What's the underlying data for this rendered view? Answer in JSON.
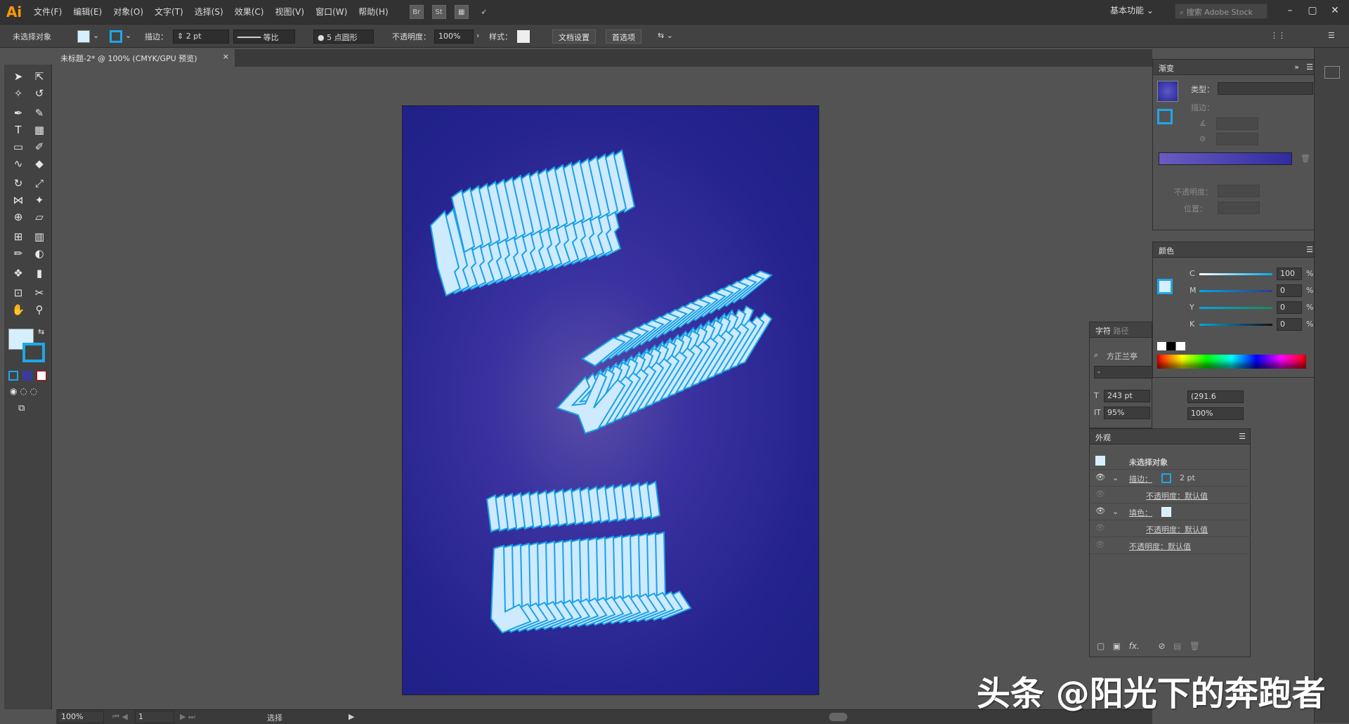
{
  "app": {
    "logo": "Ai"
  },
  "menu": [
    "文件(F)",
    "编辑(E)",
    "对象(O)",
    "文字(T)",
    "选择(S)",
    "效果(C)",
    "视图(V)",
    "窗口(W)",
    "帮助(H)"
  ],
  "menubar_icons": {
    "br": "Br",
    "st": "St"
  },
  "workspace": "基本功能",
  "stock_search": "搜索 Adobe Stock",
  "control": {
    "selection": "未选择对象",
    "stroke_label": "描边：",
    "stroke_value": "2 pt",
    "stroke_style": "等比",
    "brush": "5 点圆形",
    "opacity_label": "不透明度：",
    "opacity_value": "100%",
    "style_label": "样式：",
    "doc_setup": "文档设置",
    "prefs": "首选项",
    "fill_color": "#d6efff",
    "stroke_color": "#1fa7e6"
  },
  "document_tab": {
    "title": "未标题-2* @ 100% (CMYK/GPU 预览)",
    "close": "×"
  },
  "toolbar": {
    "tools": [
      "selection-tool",
      "direct-selection-tool",
      "magic-wand-tool",
      "lasso-tool",
      "pen-tool",
      "curvature-tool",
      "type-tool",
      "table-tool",
      "rectangle-tool",
      "paintbrush-tool",
      "shaper-tool",
      "eraser-tool",
      "rotate-tool",
      "scale-tool",
      "width-tool",
      "puppet-warp-tool",
      "shape-builder-tool",
      "perspective-tool",
      "mesh-tool",
      "gradient-tool",
      "eyedropper-tool",
      "blend-tool",
      "symbol-sprayer-tool",
      "graph-tool",
      "artboard-tool",
      "slice-tool",
      "hand-tool",
      "zoom-tool"
    ]
  },
  "artboard": {
    "bg_center": "#5a4ea6",
    "bg_edge": "#1e1f86",
    "letter_fill": "#cdeaff",
    "letter_stroke": "#1aa0e8"
  },
  "gradient_panel": {
    "title": "渐变",
    "type_label": "类型：",
    "stroke_label": "描边：",
    "opacity_label": "不透明度：",
    "position_label": "位置："
  },
  "color_panel": {
    "title": "颜色",
    "channels": [
      {
        "name": "C",
        "value": "100",
        "pct": "%"
      },
      {
        "name": "M",
        "value": "0",
        "pct": "%"
      },
      {
        "name": "Y",
        "value": "0",
        "pct": "%"
      },
      {
        "name": "K",
        "value": "0",
        "pct": "%"
      }
    ]
  },
  "character_panel": {
    "tab1": "字符",
    "tab2": "路径",
    "font": "方正兰亭",
    "style": "-",
    "size": "243 pt",
    "leading": "(291.6",
    "vscale": "95%",
    "hscale": "100%"
  },
  "appearance_panel": {
    "title": "外观",
    "object": "未选择对象",
    "stroke_label": "描边：",
    "stroke_value": "2 pt",
    "opacity1": "不透明度：默认值",
    "fill_label": "填色：",
    "opacity2": "不透明度：默认值",
    "opacity3": "不透明度：默认值"
  },
  "status": {
    "zoom": "100%",
    "page": "1",
    "mode": "选择"
  },
  "watermark": "头条 @阳光下的奔跑者"
}
